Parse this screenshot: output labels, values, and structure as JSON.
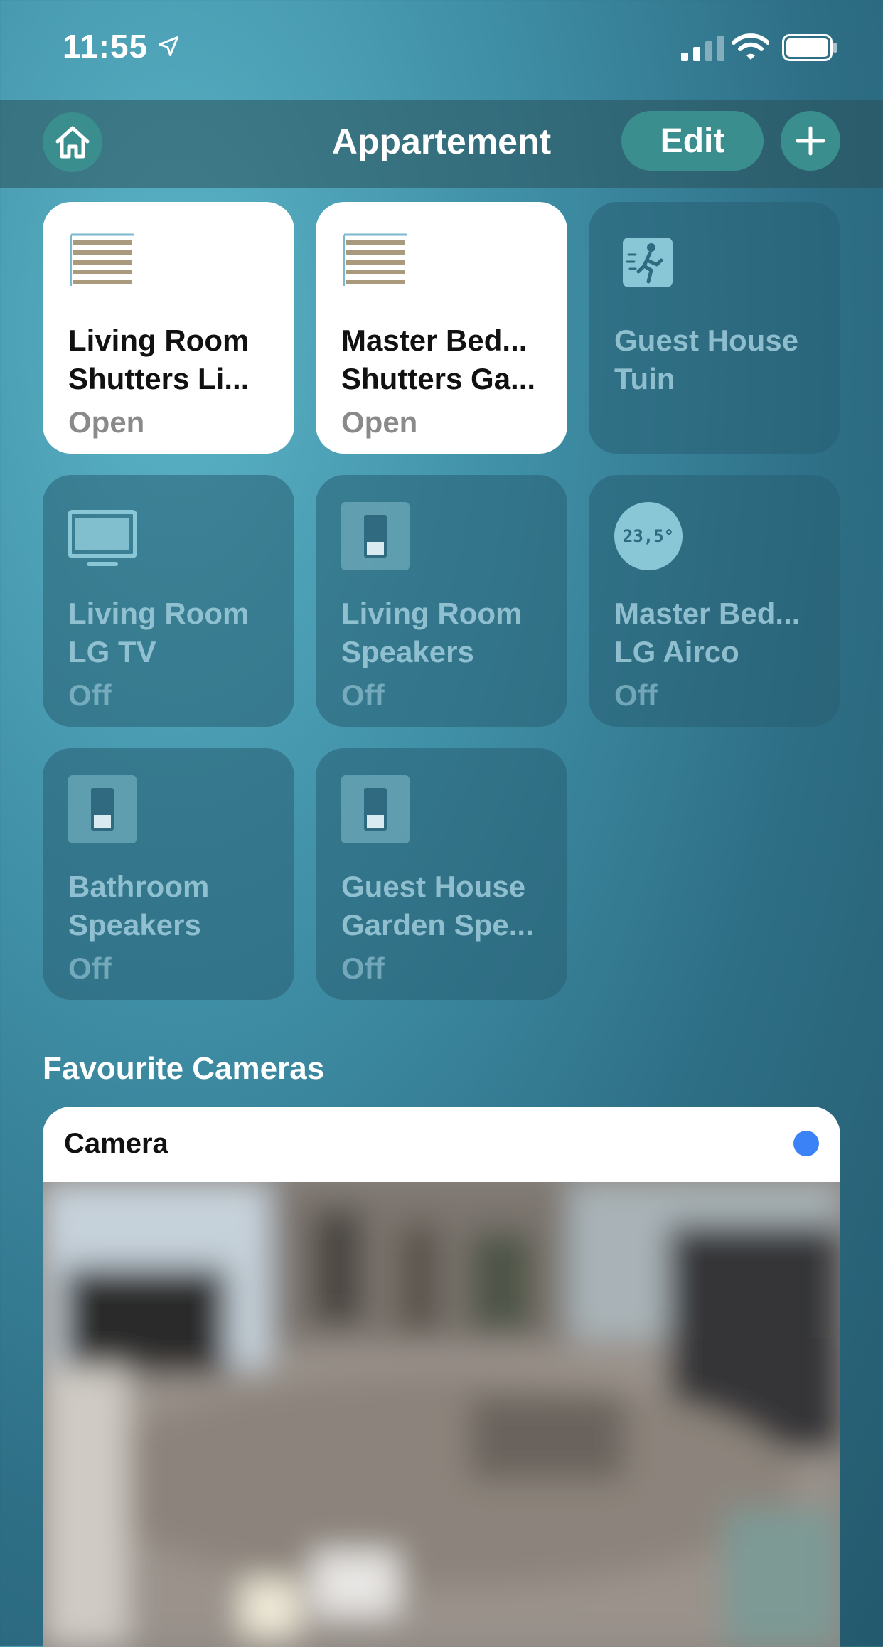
{
  "status_bar": {
    "time": "11:55",
    "icons": [
      "location-arrow-icon",
      "cellular-signal-icon",
      "wifi-icon",
      "battery-icon"
    ]
  },
  "header": {
    "title": "Appartement",
    "edit_label": "Edit",
    "home_icon": "home-icon",
    "add_icon": "plus-icon"
  },
  "accessories": [
    {
      "name_line1": "Living Room",
      "name_line2": "Shutters Li...",
      "status": "Open",
      "icon": "blinds-icon",
      "state": "on"
    },
    {
      "name_line1": "Master Bed...",
      "name_line2": "Shutters Ga...",
      "status": "Open",
      "icon": "blinds-icon",
      "state": "on"
    },
    {
      "name_line1": "Guest House",
      "name_line2": "Tuin",
      "status": "",
      "icon": "motion-sensor-icon",
      "state": "off"
    },
    {
      "name_line1": "Living Room",
      "name_line2": "LG TV",
      "status": "Off",
      "icon": "tv-icon",
      "state": "off"
    },
    {
      "name_line1": "Living Room",
      "name_line2": "Speakers",
      "status": "Off",
      "icon": "switch-icon",
      "state": "off"
    },
    {
      "name_line1": "Master Bed...",
      "name_line2": "LG Airco",
      "status": "Off",
      "icon": "thermostat-icon",
      "temperature": "23,5°",
      "state": "off"
    },
    {
      "name_line1": "Bathroom",
      "name_line2": "Speakers",
      "status": "Off",
      "icon": "switch-icon",
      "state": "off"
    },
    {
      "name_line1": "Guest House",
      "name_line2": "Garden Spe...",
      "status": "Off",
      "icon": "switch-icon",
      "state": "off"
    }
  ],
  "cameras_section": {
    "title": "Favourite Cameras",
    "camera": {
      "label": "Camera",
      "indicator_color": "#3b82f6"
    }
  },
  "colors": {
    "accent": "#3a8e8e",
    "tile_on": "#ffffff",
    "tile_off": "#2f6a80"
  }
}
